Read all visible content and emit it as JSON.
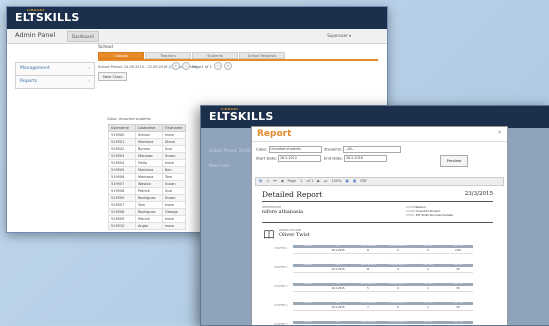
{
  "back_window": {
    "logo_small": "LIBRARY",
    "logo_a": "ELT",
    "logo_b": "SKILLS",
    "app_title": "Admin Panel",
    "dashboard_button": "Dashboard",
    "user_menu": "Superuser ▾",
    "sidebar": [
      {
        "label": "Management"
      },
      {
        "label": "Reports"
      }
    ],
    "school_label": "School",
    "tabs": [
      {
        "label": "Classes"
      },
      {
        "label": "Teachers"
      },
      {
        "label": "Students"
      },
      {
        "label": "School Requests"
      }
    ],
    "period_label": "School Period:",
    "period_value": "24.09.2015 - 22.09.2016",
    "period_link": "[Change Period]",
    "new_class_button": "New Class",
    "pager_text": "Page1 of 1",
    "class_line": "Class: Unsorted students",
    "table": {
      "headers": [
        "Username",
        "Lastname",
        "Firstname"
      ],
      "rows": [
        [
          "519500",
          "School",
          "more"
        ],
        [
          "519501",
          "Montana",
          "Steve"
        ],
        [
          "519502",
          "Byrnes",
          "Susi"
        ],
        [
          "519503",
          "Marzoso",
          "Susan"
        ],
        [
          "519504",
          "Hello",
          "more"
        ],
        [
          "519505",
          "Montana",
          "Ben"
        ],
        [
          "519506",
          "Montana",
          "Tom"
        ],
        [
          "519507",
          "Waston",
          "Susan"
        ],
        [
          "519508",
          "Patrick",
          "Susi"
        ],
        [
          "519509",
          "Rodriguez",
          "Susan"
        ],
        [
          "519507",
          "Tom",
          "more"
        ],
        [
          "519508",
          "Rodriguez",
          "George"
        ],
        [
          "519509",
          "Patrick",
          "more"
        ],
        [
          "519510",
          "Angie",
          "more"
        ]
      ]
    }
  },
  "front_window": {
    "logo_small": "LIBRARY",
    "logo_a": "ELT",
    "logo_b": "SKILLS",
    "dialog_title": "Report",
    "close_symbol": "×",
    "class_label": "Class:",
    "class_value": "Unsorted students",
    "students_label": "Students:",
    "students_value": "--All--",
    "start_label": "Start Date:",
    "start_value": "26.5.2015",
    "end_label": "End Date:",
    "end_value": "26.5.2016",
    "preview_button": "Preview",
    "toolbar": {
      "page_label": "Page",
      "page_value": "1",
      "of_text": "of 1",
      "zoom_value": "100%",
      "format_value": "PDF"
    },
    "report": {
      "title": "Detailed Report",
      "date": "23/3/2015",
      "intermediate_label": "INTERMEDIATE",
      "intermediate_name": "nifore athanasia",
      "school_key": "SCHOOL:",
      "school_value": "Ireland",
      "class_key": "CLASS:",
      "class_value": "Unsorted student",
      "level_key": "LEVEL:",
      "level_value": "ELT Skills Pre-Intermediate",
      "reader_label": "LIBRARY READER",
      "reader_name": "Oliver Twist",
      "column_headers": [
        "Attempts",
        "Date",
        "Correct Answers",
        "Incorrect Answers",
        "Hint Used",
        "Total Time"
      ],
      "chapters": [
        {
          "label": "CHAPTER 1",
          "values": [
            "",
            "18.1.2015",
            "8",
            "0",
            "0",
            "2:00"
          ]
        },
        {
          "label": "CHAPTER 2",
          "values": [
            "",
            "19.1.2015",
            "11",
            "4",
            "2",
            "40"
          ]
        },
        {
          "label": "CHAPTER 3",
          "values": [
            "",
            "19.1.2015",
            "5",
            "4",
            "1",
            "30"
          ]
        },
        {
          "label": "CHAPTER 4",
          "values": [
            "",
            "19.1.2015",
            "7",
            "0",
            "1",
            "30"
          ]
        },
        {
          "label": "CHAPTER 5",
          "values": [
            "",
            "",
            "",
            "",
            "",
            ""
          ]
        }
      ]
    },
    "ghost_text_1": "School Period: 24.09.2015 - 22.09.2016",
    "ghost_text_2": "New Class"
  },
  "colors": {
    "navbar": "#1c2f4c",
    "accent_orange": "#e8892a",
    "link_blue": "#3a6ea5",
    "background": "#b9d2e8"
  }
}
